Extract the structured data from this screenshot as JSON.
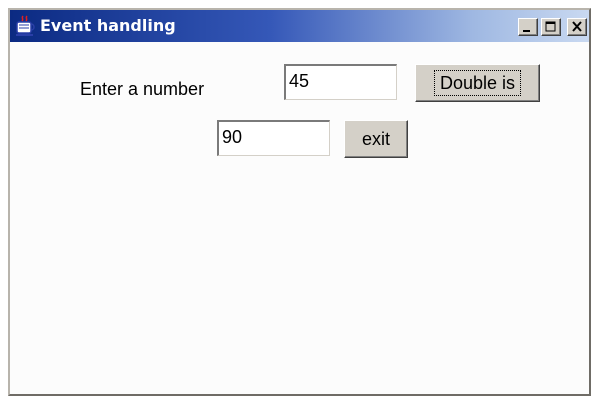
{
  "window": {
    "title": "Event handling",
    "icon": "java-coffee-cup-icon",
    "controls": {
      "minimize": "minimize-icon",
      "maximize": "maximize-icon",
      "close": "close-icon"
    }
  },
  "form": {
    "prompt_label": "Enter a number",
    "number_value": "45",
    "double_button_label": "Double is",
    "result_value": "90",
    "exit_button_label": "exit"
  },
  "colors": {
    "titlebar_start": "#0b2a82",
    "titlebar_end": "#c9d9f1",
    "button_face": "#d4d0c8",
    "client_background": "#fcfcfc"
  }
}
